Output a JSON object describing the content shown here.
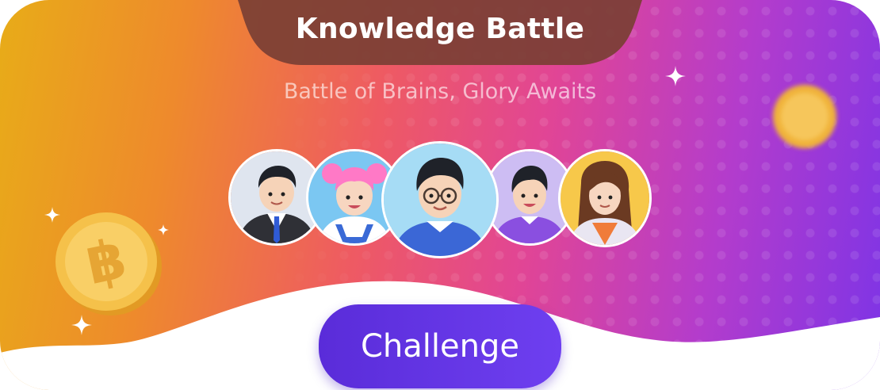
{
  "banner": {
    "title": "Knowledge Battle",
    "subtitle": "Battle of Brains, Glory Awaits",
    "button_label": "Challenge"
  },
  "avatars": [
    {
      "name": "avatar-man-suit",
      "shirt": "#2f3036",
      "hair": "#1f2229",
      "bg": "#dfe5ef"
    },
    {
      "name": "avatar-girl-pink-hair",
      "shirt": "#3a6ad6",
      "hair": "#ff79c6",
      "bg": "#7bc7f2"
    },
    {
      "name": "avatar-man-glasses",
      "shirt": "#3b67d6",
      "hair": "#1f2229",
      "bg": "#a6dcf5"
    },
    {
      "name": "avatar-boy-purple",
      "shirt": "#8a4fe0",
      "hair": "#1f2229",
      "bg": "#cdbdf3"
    },
    {
      "name": "avatar-woman-long-hair",
      "shirt": "#f07c3a",
      "hair": "#6b3a22",
      "bg": "#f7c84a"
    }
  ],
  "colors": {
    "gradient_start": "#e8ac18",
    "gradient_mid": "#e14595",
    "gradient_end": "#7d34e6",
    "button": "#6a3be8",
    "title_tab": "#7a3f34",
    "coin": "#f2b63b"
  }
}
